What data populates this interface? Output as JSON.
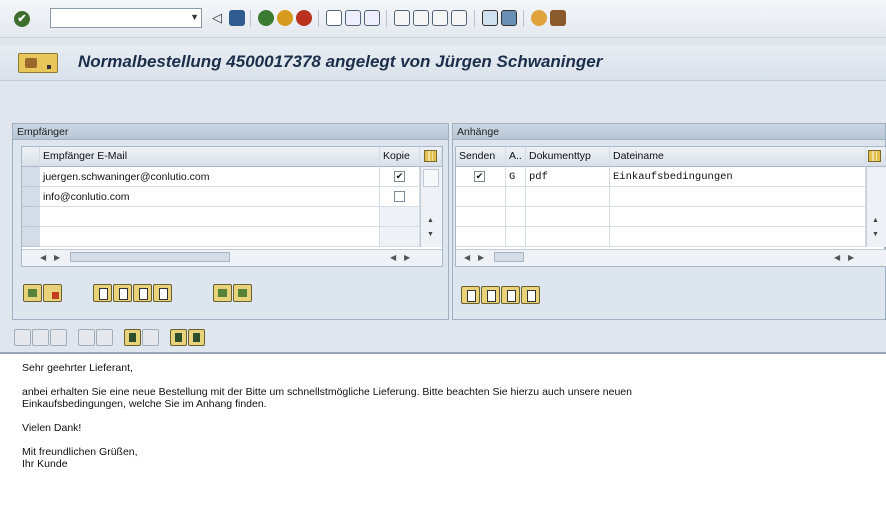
{
  "toolbar": {
    "command_value": ""
  },
  "title": "Normalbestellung 4500017378 angelegt von Jürgen Schwaninger",
  "recipients": {
    "heading": "Empfänger",
    "columns": [
      "Empfänger E-Mail",
      "Kopie"
    ],
    "rows": [
      {
        "email": "juergen.schwaninger@conlutio.com",
        "copy": true
      },
      {
        "email": "info@conlutio.com",
        "copy": false
      }
    ]
  },
  "attachments": {
    "heading": "Anhänge",
    "columns": [
      "Senden",
      "A..",
      "Dokumenttyp",
      "Dateiname"
    ],
    "rows": [
      {
        "send": true,
        "a": "G",
        "doctype": "pdf",
        "filename": "Einkaufsbedingungen"
      }
    ]
  },
  "editor": {
    "lines": [
      "Sehr geehrter Lieferant,",
      "",
      "anbei erhalten Sie eine neue Bestellung mit der Bitte um schnellstmögliche Lieferung. Bitte beachten Sie hierzu auch unsere neuen",
      "Einkaufsbedingungen, welche Sie im Anhang finden.",
      "",
      "Vielen Dank!",
      "",
      "Mit freundlichen Grüßen,",
      "Ihr Kunde"
    ]
  },
  "icons": [
    "enter-icon",
    "back-icon",
    "save-icon",
    "exit-icon",
    "cancel-icon",
    "print-icon",
    "find-icon",
    "find-next-icon",
    "first-page-icon",
    "previous-page-icon",
    "next-page-icon",
    "last-page-icon",
    "new-session-icon",
    "shortcut-icon",
    "help-icon",
    "customize-layout-icon"
  ],
  "colors": {
    "accent": "#e8d27a",
    "title_text": "#1c2f4a",
    "panel_bg": "#dde5ee"
  }
}
